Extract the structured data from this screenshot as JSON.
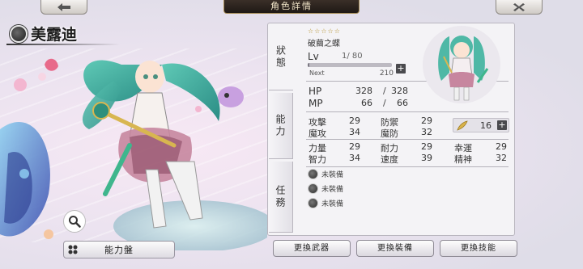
{
  "header": {
    "title": "角色詳情"
  },
  "character": {
    "name": "美露迪",
    "rarity_stars": "☆☆☆☆☆",
    "title": "破繭之蝶"
  },
  "level": {
    "label": "Lv",
    "current": "1",
    "max": "/ 80",
    "progress": 0.02,
    "next_label": "Next",
    "next_value": "210"
  },
  "hp": {
    "label": "HP",
    "current": "328",
    "sep": "/",
    "max": "328"
  },
  "mp": {
    "label": "MP",
    "current": "66",
    "sep": "/",
    "max": "66"
  },
  "tabs": {
    "status": "狀態",
    "ability": "能力",
    "task": "任務"
  },
  "stats": [
    {
      "label": "攻擊",
      "value": "29"
    },
    {
      "label": "防禦",
      "value": "29"
    },
    {
      "label": "魔攻",
      "value": "34"
    },
    {
      "label": "魔防",
      "value": "32"
    },
    {
      "label": "力量",
      "value": "29"
    },
    {
      "label": "耐力",
      "value": "29"
    },
    {
      "label": "幸運",
      "value": "29"
    },
    {
      "label": "智力",
      "value": "34"
    },
    {
      "label": "速度",
      "value": "39"
    },
    {
      "label": "精神",
      "value": "32"
    }
  ],
  "points": {
    "value": "16"
  },
  "equipment": [
    {
      "label": "未裝備",
      "icon": "weapon-slot-icon"
    },
    {
      "label": "未裝備",
      "icon": "armor-slot-icon"
    },
    {
      "label": "未裝備",
      "icon": "skill-slot-icon"
    }
  ],
  "buttons": {
    "ability_board": "能力盤",
    "change_weapon": "更換武器",
    "change_gear": "更換裝備",
    "change_skill": "更換技能"
  },
  "colors": {
    "panel_bg": "#f4f3f6",
    "header_bg": "#2a221d",
    "header_gold": "#a58a52"
  }
}
